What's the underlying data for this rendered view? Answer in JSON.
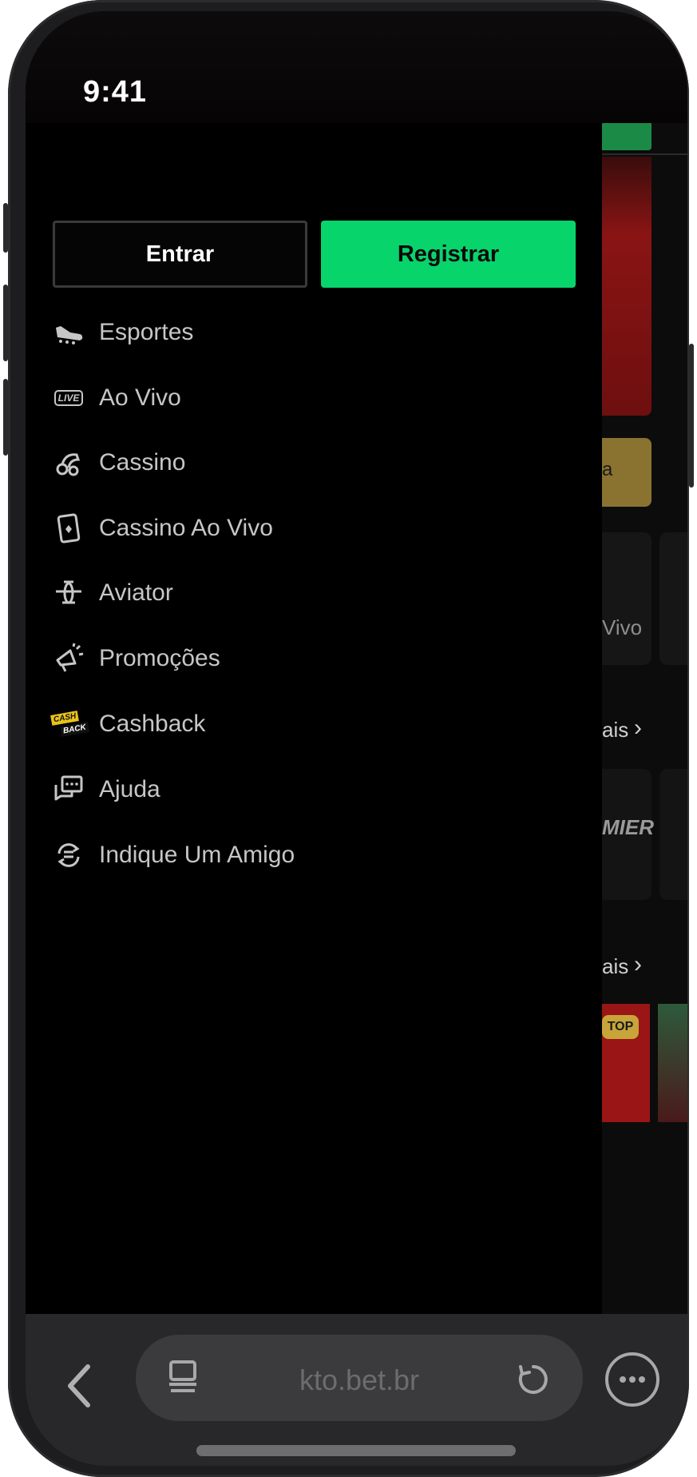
{
  "status": {
    "time": "9:41"
  },
  "auth": {
    "login_label": "Entrar",
    "register_label": "Registrar"
  },
  "menu": [
    {
      "label": "Esportes",
      "icon": "soccer-boot-icon"
    },
    {
      "label": "Ao Vivo",
      "icon": "live-icon",
      "badge": "LIVE"
    },
    {
      "label": "Cassino",
      "icon": "slot-machine-icon"
    },
    {
      "label": "Cassino Ao Vivo",
      "icon": "playing-card-icon"
    },
    {
      "label": "Aviator",
      "icon": "airplane-icon"
    },
    {
      "label": "Promoções",
      "icon": "megaphone-icon"
    },
    {
      "label": "Cashback",
      "icon": "cashback-icon",
      "badge_top": "CASH",
      "badge_bottom": "BACK"
    },
    {
      "label": "Ajuda",
      "icon": "chat-bubbles-icon"
    },
    {
      "label": "Indique Um Amigo",
      "icon": "refer-friend-icon"
    }
  ],
  "background_page": {
    "fragments": [
      "a",
      "Vivo",
      "ais",
      "MIER",
      "ais"
    ],
    "badge": "TOP"
  },
  "browser": {
    "url": "kto.bet.br"
  },
  "colors": {
    "accent": "#08d46c",
    "drawer_bg": "#000000",
    "menu_text": "#c6c6c6",
    "bar_bg": "#28282a"
  }
}
